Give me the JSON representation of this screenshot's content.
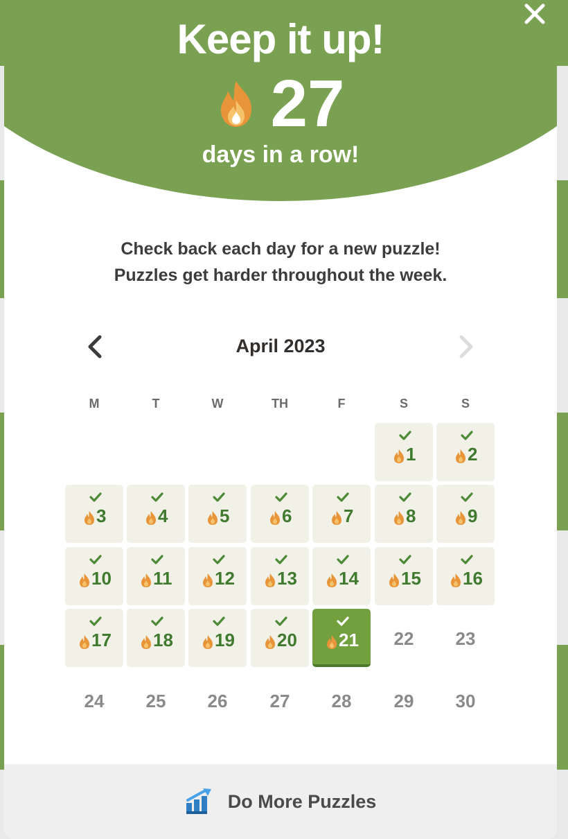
{
  "modal": {
    "title": "Keep it up!",
    "streak_count": "27",
    "streak_caption": "days in a row!",
    "info_line1": "Check back each day for a new puzzle!",
    "info_line2": "Puzzles get harder throughout the week."
  },
  "calendar": {
    "month_label": "April 2023",
    "weekdays": [
      "M",
      "T",
      "W",
      "TH",
      "F",
      "S",
      "S"
    ],
    "days": [
      {
        "day": "1",
        "status": "solved"
      },
      {
        "day": "2",
        "status": "solved"
      },
      {
        "day": "3",
        "status": "solved"
      },
      {
        "day": "4",
        "status": "solved"
      },
      {
        "day": "5",
        "status": "solved"
      },
      {
        "day": "6",
        "status": "solved"
      },
      {
        "day": "7",
        "status": "solved"
      },
      {
        "day": "8",
        "status": "solved"
      },
      {
        "day": "9",
        "status": "solved"
      },
      {
        "day": "10",
        "status": "solved"
      },
      {
        "day": "11",
        "status": "solved"
      },
      {
        "day": "12",
        "status": "solved"
      },
      {
        "day": "13",
        "status": "solved"
      },
      {
        "day": "14",
        "status": "solved"
      },
      {
        "day": "15",
        "status": "solved"
      },
      {
        "day": "16",
        "status": "solved"
      },
      {
        "day": "17",
        "status": "solved"
      },
      {
        "day": "18",
        "status": "solved"
      },
      {
        "day": "19",
        "status": "solved"
      },
      {
        "day": "20",
        "status": "solved"
      },
      {
        "day": "21",
        "status": "today"
      },
      {
        "day": "22",
        "status": "future"
      },
      {
        "day": "23",
        "status": "future"
      },
      {
        "day": "24",
        "status": "future"
      },
      {
        "day": "25",
        "status": "future"
      },
      {
        "day": "26",
        "status": "future"
      },
      {
        "day": "27",
        "status": "future"
      },
      {
        "day": "28",
        "status": "future"
      },
      {
        "day": "29",
        "status": "future"
      },
      {
        "day": "30",
        "status": "future"
      }
    ]
  },
  "footer": {
    "label": "Do More Puzzles",
    "icon": "bar-chart-arrow-icon"
  },
  "colors": {
    "brand_green": "#7aa152",
    "solved_bg": "#f2f1e8",
    "today_bg": "#72a03f",
    "day_number": "#3f7a2f",
    "flame": "#e8953a"
  }
}
